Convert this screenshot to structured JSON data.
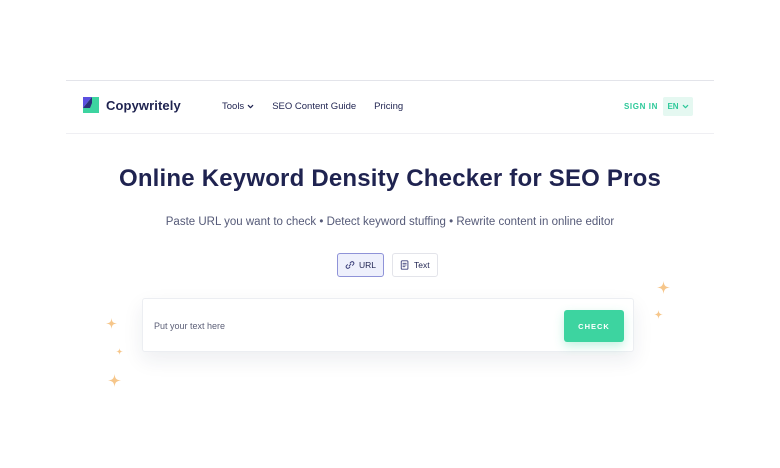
{
  "brand": {
    "name": "Copywritely",
    "logo_icon": "copywritely-logo-icon"
  },
  "nav": {
    "links": [
      {
        "label": "Tools",
        "has_dropdown": true
      },
      {
        "label": "SEO Content Guide",
        "has_dropdown": false
      },
      {
        "label": "Pricing",
        "has_dropdown": false
      }
    ],
    "sign_in": "SIGN IN",
    "language": "EN"
  },
  "hero": {
    "title": "Online Keyword Density Checker for SEO Pros",
    "subtitle": "Paste URL you want to check • Detect keyword stuffing • Rewrite content in online editor"
  },
  "modes": [
    {
      "label": "URL",
      "icon": "link-icon",
      "selected": true
    },
    {
      "label": "Text",
      "icon": "document-icon",
      "selected": false
    }
  ],
  "checker": {
    "placeholder": "Put your text here",
    "value": "",
    "button_label": "CHECK"
  },
  "colors": {
    "brand_navy": "#1f2350",
    "accent_green": "#3dd4a0",
    "sign_in_green": "#2ec99a",
    "sparkle_orange": "#f6c68a",
    "url_active_border": "#8f93d8"
  }
}
